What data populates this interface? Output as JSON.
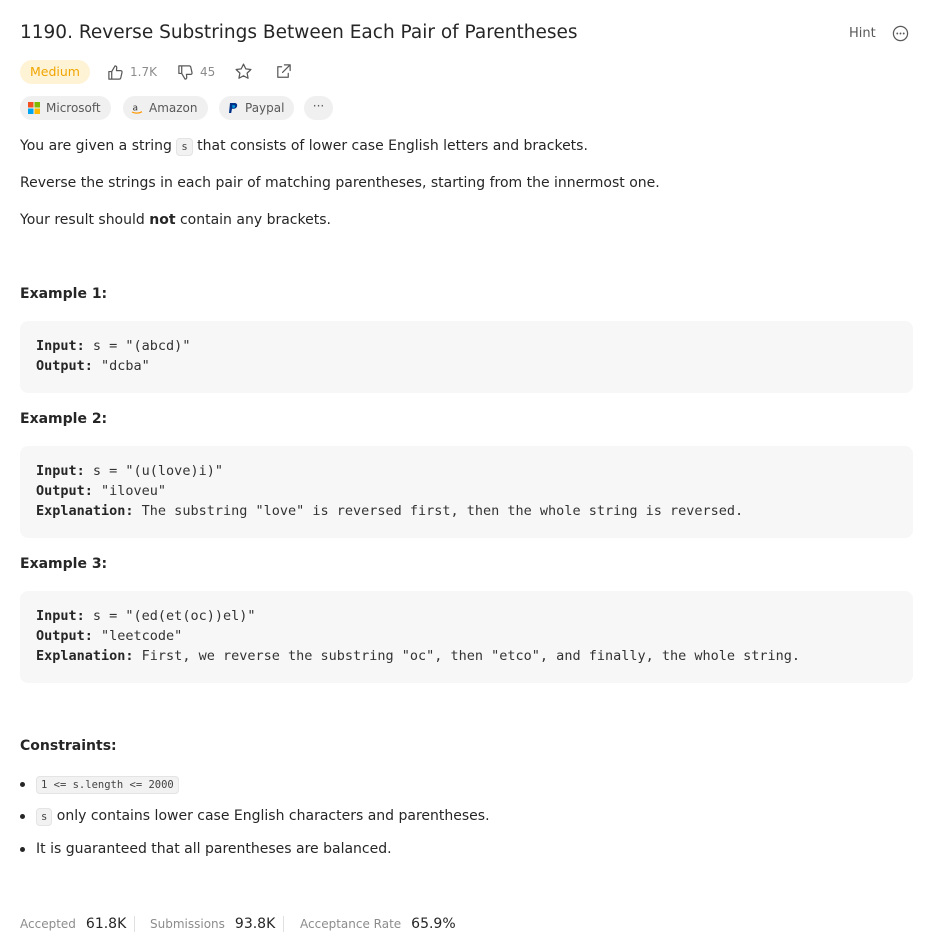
{
  "problem": {
    "title": "1190. Reverse Substrings Between Each Pair of Parentheses",
    "hint_label": "Hint",
    "difficulty": "Medium",
    "likes": "1.7K",
    "dislikes": "45",
    "companies": [
      "Microsoft",
      "Amazon",
      "Paypal"
    ],
    "more_companies": "···"
  },
  "description": {
    "p1_before": "You are given a string ",
    "p1_code": "s",
    "p1_after": " that consists of lower case English letters and brackets.",
    "p2": "Reverse the strings in each pair of matching parentheses, starting from the innermost one.",
    "p3_before": "Your result should ",
    "p3_bold": "not",
    "p3_after": " contain any brackets."
  },
  "examples": [
    {
      "heading": "Example 1:",
      "input_label": "Input:",
      "input": " s = \"(abcd)\"",
      "output_label": "Output:",
      "output": " \"dcba\""
    },
    {
      "heading": "Example 2:",
      "input_label": "Input:",
      "input": " s = \"(u(love)i)\"",
      "output_label": "Output:",
      "output": " \"iloveu\"",
      "explanation_label": "Explanation:",
      "explanation": " The substring \"love\" is reversed first, then the whole string is reversed."
    },
    {
      "heading": "Example 3:",
      "input_label": "Input:",
      "input": " s = \"(ed(et(oc))el)\"",
      "output_label": "Output:",
      "output": " \"leetcode\"",
      "explanation_label": "Explanation:",
      "explanation": " First, we reverse the substring \"oc\", then \"etco\", and finally, the whole string."
    }
  ],
  "constraints": {
    "heading": "Constraints:",
    "c1_code": "1 <= s.length <= 2000",
    "c2_code": "s",
    "c2_text": " only contains lower case English characters and parentheses.",
    "c3": "It is guaranteed that all parentheses are balanced."
  },
  "stats": {
    "accepted_label": "Accepted",
    "accepted": "61.8K",
    "submissions_label": "Submissions",
    "submissions": "93.8K",
    "rate_label": "Acceptance Rate",
    "rate": "65.9%"
  },
  "colors": {
    "difficulty_medium": "#f0a500",
    "difficulty_bg": "#fff3d6"
  },
  "icons": [
    "thumbs-up-icon",
    "thumbs-down-icon",
    "star-icon",
    "share-icon",
    "more-icon",
    "microsoft-logo-icon",
    "amazon-logo-icon",
    "paypal-logo-icon"
  ]
}
